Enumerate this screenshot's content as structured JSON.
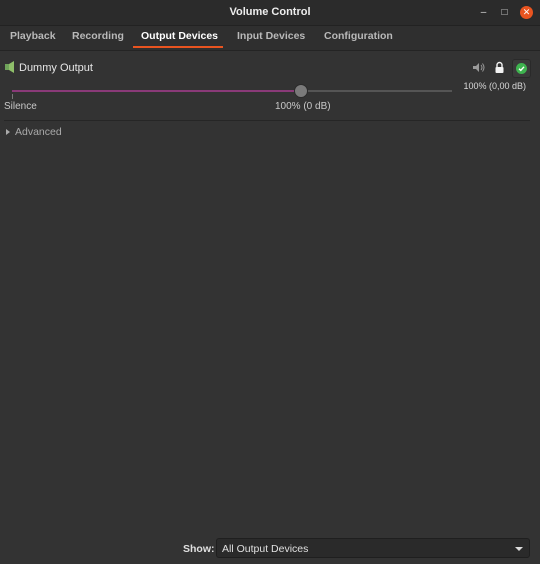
{
  "window": {
    "title": "Volume Control",
    "minimize": "–",
    "maximize": "□",
    "close": "✕"
  },
  "tabs": [
    {
      "label": "Playback",
      "active": false
    },
    {
      "label": "Recording",
      "active": false
    },
    {
      "label": "Output Devices",
      "active": true
    },
    {
      "label": "Input Devices",
      "active": false
    },
    {
      "label": "Configuration",
      "active": false
    }
  ],
  "device": {
    "name": "Dummy Output",
    "peak_label": "100% (0,00 dB)",
    "volume_percent": 100,
    "scale_labels": {
      "silence": "Silence",
      "hundred": "100% (0 dB)"
    },
    "icons": {
      "device": "audio-card-icon",
      "mute": "speaker-mute-icon",
      "lock": "lock-icon",
      "default": "check-circle-icon"
    }
  },
  "advanced": {
    "label": "Advanced"
  },
  "footer": {
    "show_label": "Show:",
    "show_value": "All Output Devices"
  },
  "colors": {
    "accent": "#e95420",
    "slider_fill": "#8a3a78",
    "check": "#3eb34f"
  }
}
